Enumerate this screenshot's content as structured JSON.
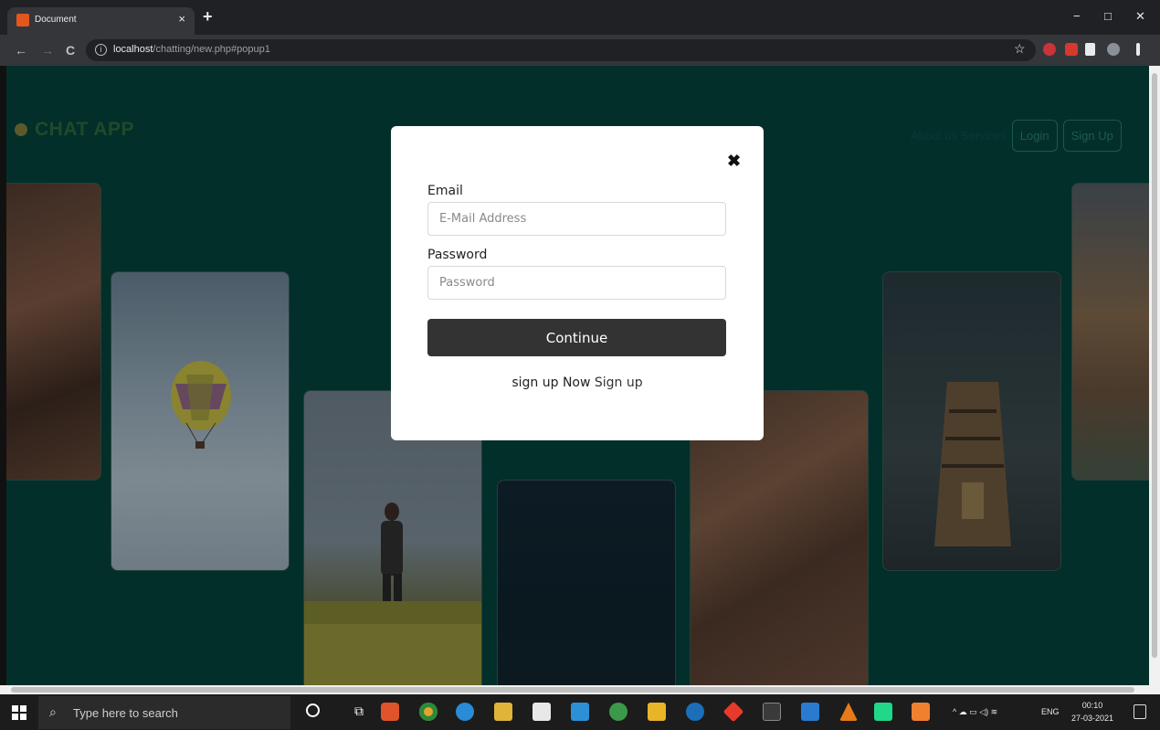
{
  "browser": {
    "tab_title": "Document",
    "tab_close": "×",
    "new_tab": "+",
    "window_minimize": "−",
    "window_maximize": "□",
    "window_close": "✕",
    "nav_back": "←",
    "nav_forward": "→",
    "nav_reload": "C",
    "url_host": "localhost",
    "url_path": "/chatting/new.php#popup1",
    "bookmark_star": "☆"
  },
  "header": {
    "brand": "CHAT APP",
    "nav_text": "About us Services",
    "login_label": "Login",
    "signup_label": "Sign Up"
  },
  "modal": {
    "close_glyph": "✖",
    "email_label": "Email",
    "email_placeholder": "E-Mail Address",
    "email_value": "",
    "password_label": "Password",
    "password_placeholder": "Password",
    "password_value": "",
    "continue_label": "Continue",
    "signup_prefix": "sign up Now",
    "signup_link": "Sign up"
  },
  "taskbar": {
    "search_placeholder": "Type here to search",
    "tray_language": "ENG",
    "clock_time": "00:10",
    "clock_date": "27-03-2021"
  },
  "colors": {
    "page_background": "#032f2a",
    "continue_button": "#333333",
    "modal_background": "#ffffff"
  }
}
